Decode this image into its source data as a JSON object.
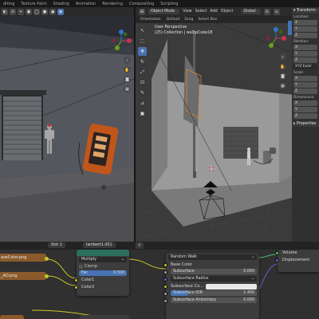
{
  "workspace_tabs": [
    "diting",
    "Texture Paint",
    "Shading",
    "Animation",
    "Rendering",
    "Compositing",
    "Scripting"
  ],
  "colors": {
    "accent": "#4772b3",
    "image_texture_header": "#8a5a2a",
    "converter_header": "#2c6f5c",
    "shader_header": "#2e6a3d",
    "socket_yellow": "#c7c729",
    "socket_grey": "#a1a1a1",
    "socket_purple": "#6363c7",
    "gizmo_x": "#c5344f",
    "gizmo_y": "#6a9f1f",
    "gizmo_z": "#2e77c6"
  },
  "right_viewport": {
    "mode": "Object Mode",
    "menus": [
      "View",
      "Select",
      "Add",
      "Object"
    ],
    "orientation_label": "Orientation:",
    "orientation_value": "Default",
    "drag_label": "Drag",
    "drag_value": "Select Box",
    "transform_global": "Global",
    "view_name": "User Perspective",
    "collection_info": "(25) Collection | wall\\pCube18",
    "tools": [
      "cursor",
      "select",
      "move",
      "rotate",
      "scale",
      "transform",
      "annotate",
      "measure",
      "add-cube"
    ]
  },
  "npanel": {
    "transform_header": "Transform",
    "location_label": "Location:",
    "location_axes": [
      "X",
      "Y",
      "Z"
    ],
    "rotation_label": "Rotation:",
    "rotation_axes": [
      "X",
      "Y",
      "Z"
    ],
    "rotation_mode": "XYZ Euler",
    "scale_label": "Scale:",
    "scale_axes": [
      "X",
      "Y",
      "Z"
    ],
    "dimensions_label": "Dimensions:",
    "dimensions_axes": [
      "X",
      "Y",
      "Z"
    ],
    "properties_header": "Properties"
  },
  "node_editor": {
    "slot": "Slot 1",
    "material": "lambert1.001",
    "tex_base_color": "aseColor.png",
    "tex_ao": "_AO.png",
    "mix_node": {
      "blend_mode": "Multiply",
      "clamp_label": "Clamp",
      "fac_label": "Fac",
      "fac_value": "0.500",
      "inputs": [
        "Color1",
        "Color2"
      ]
    },
    "bsdf_node": {
      "subsurface_method": "Random Walk",
      "base_color_label": "Base Color",
      "subsurface_label": "Subsurface",
      "subsurface_value": "0.000",
      "subsurface_radius_label": "Subsurface Radius",
      "subsurface_color_label": "Subsurface Co...",
      "subsurface_ior_label": "Subsurface IOR",
      "subsurface_ior_value": "1.400",
      "subsurface_anisotropy_label": "Subsurface Anisotropy",
      "subsurface_anisotropy_value": "0.000"
    },
    "output_node": {
      "inputs": [
        "Volume",
        "Displacement"
      ]
    }
  }
}
